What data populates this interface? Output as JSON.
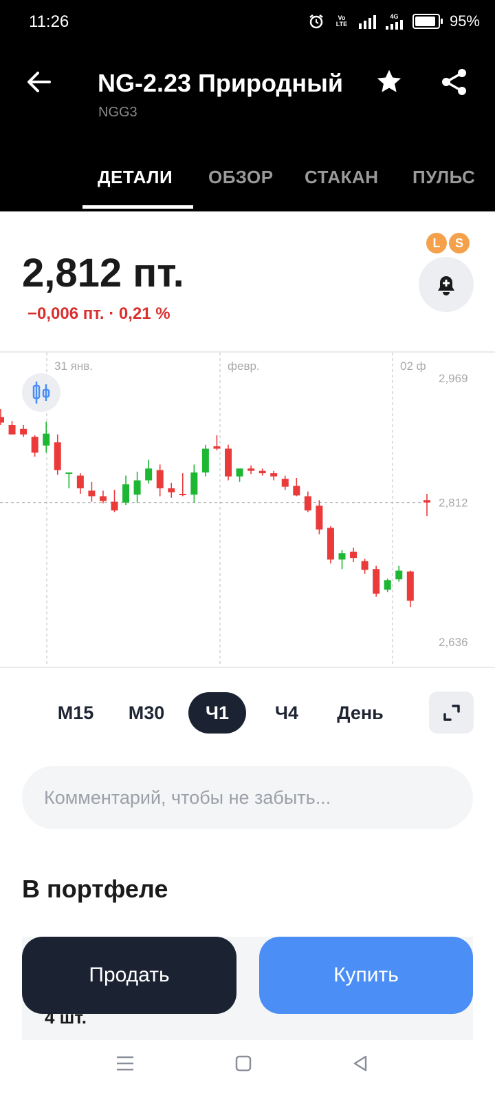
{
  "status_bar": {
    "time": "11:26",
    "battery": "95%",
    "volte": "Vo LTE",
    "network": "4G"
  },
  "header": {
    "title": "NG-2.23 Природный",
    "ticker": "NGG3"
  },
  "tabs": [
    {
      "label": "ДЕТАЛИ",
      "active": true
    },
    {
      "label": "ОБЗОР",
      "active": false
    },
    {
      "label": "СТАКАН",
      "active": false
    },
    {
      "label": "ПУЛЬС",
      "active": false
    }
  ],
  "price": {
    "value": "2,812 пт.",
    "change": "−0,006 пт. · 0,21 %",
    "badge_l": "L",
    "badge_s": "S"
  },
  "chart_data": {
    "type": "candlestick",
    "x_labels": [
      "31 янв.",
      "февр.",
      "02 ф"
    ],
    "y_ticks": [
      "2,969",
      "2,812",
      "2,636"
    ],
    "ylim": [
      2.616,
      2.99
    ],
    "current_price": 2.812,
    "colors": {
      "up": "#1db733",
      "down": "#ea3a3a"
    },
    "candles": [
      {
        "o": 2.92,
        "h": 2.93,
        "l": 2.91,
        "c": 2.913
      },
      {
        "o": 2.91,
        "h": 2.915,
        "l": 2.898,
        "c": 2.898
      },
      {
        "o": 2.905,
        "h": 2.91,
        "l": 2.895,
        "c": 2.898
      },
      {
        "o": 2.895,
        "h": 2.897,
        "l": 2.87,
        "c": 2.875
      },
      {
        "o": 2.884,
        "h": 2.914,
        "l": 2.875,
        "c": 2.899
      },
      {
        "o": 2.888,
        "h": 2.898,
        "l": 2.847,
        "c": 2.853
      },
      {
        "o": 2.85,
        "h": 2.85,
        "l": 2.83,
        "c": 2.85
      },
      {
        "o": 2.846,
        "h": 2.849,
        "l": 2.823,
        "c": 2.83
      },
      {
        "o": 2.827,
        "h": 2.838,
        "l": 2.813,
        "c": 2.82
      },
      {
        "o": 2.82,
        "h": 2.827,
        "l": 2.811,
        "c": 2.814
      },
      {
        "o": 2.813,
        "h": 2.828,
        "l": 2.8,
        "c": 2.802
      },
      {
        "o": 2.812,
        "h": 2.846,
        "l": 2.809,
        "c": 2.835
      },
      {
        "o": 2.822,
        "h": 2.851,
        "l": 2.812,
        "c": 2.84
      },
      {
        "o": 2.84,
        "h": 2.866,
        "l": 2.836,
        "c": 2.855
      },
      {
        "o": 2.853,
        "h": 2.86,
        "l": 2.82,
        "c": 2.83
      },
      {
        "o": 2.83,
        "h": 2.837,
        "l": 2.818,
        "c": 2.825
      },
      {
        "o": 2.823,
        "h": 2.849,
        "l": 2.82,
        "c": 2.822
      },
      {
        "o": 2.822,
        "h": 2.86,
        "l": 2.812,
        "c": 2.85
      },
      {
        "o": 2.85,
        "h": 2.885,
        "l": 2.845,
        "c": 2.88
      },
      {
        "o": 2.883,
        "h": 2.897,
        "l": 2.878,
        "c": 2.88
      },
      {
        "o": 2.88,
        "h": 2.885,
        "l": 2.84,
        "c": 2.845
      },
      {
        "o": 2.845,
        "h": 2.851,
        "l": 2.838,
        "c": 2.855
      },
      {
        "o": 2.855,
        "h": 2.859,
        "l": 2.848,
        "c": 2.852
      },
      {
        "o": 2.852,
        "h": 2.855,
        "l": 2.846,
        "c": 2.849
      },
      {
        "o": 2.849,
        "h": 2.852,
        "l": 2.84,
        "c": 2.845
      },
      {
        "o": 2.842,
        "h": 2.846,
        "l": 2.828,
        "c": 2.832
      },
      {
        "o": 2.833,
        "h": 2.843,
        "l": 2.82,
        "c": 2.821
      },
      {
        "o": 2.82,
        "h": 2.826,
        "l": 2.8,
        "c": 2.802
      },
      {
        "o": 2.808,
        "h": 2.815,
        "l": 2.772,
        "c": 2.778
      },
      {
        "o": 2.78,
        "h": 2.782,
        "l": 2.735,
        "c": 2.74
      },
      {
        "o": 2.74,
        "h": 2.752,
        "l": 2.728,
        "c": 2.748
      },
      {
        "o": 2.75,
        "h": 2.755,
        "l": 2.737,
        "c": 2.742
      },
      {
        "o": 2.738,
        "h": 2.741,
        "l": 2.722,
        "c": 2.727
      },
      {
        "o": 2.728,
        "h": 2.732,
        "l": 2.693,
        "c": 2.697
      },
      {
        "o": 2.702,
        "h": 2.716,
        "l": 2.699,
        "c": 2.714
      },
      {
        "o": 2.715,
        "h": 2.732,
        "l": 2.712,
        "c": 2.726
      },
      {
        "o": 2.725,
        "h": 2.726,
        "l": 2.68,
        "c": 2.688
      },
      {
        "o": 2.815,
        "h": 2.823,
        "l": 2.795,
        "c": 2.812
      }
    ]
  },
  "timeframes": [
    {
      "label": "M15",
      "active": false
    },
    {
      "label": "M30",
      "active": false
    },
    {
      "label": "Ч1",
      "active": true
    },
    {
      "label": "Ч4",
      "active": false
    },
    {
      "label": "День",
      "active": false
    }
  ],
  "comment": {
    "placeholder": "Комментарий, чтобы не забыть..."
  },
  "portfolio": {
    "title": "В портфеле",
    "quantity": "4 шт."
  },
  "actions": {
    "sell": "Продать",
    "buy": "Купить"
  }
}
